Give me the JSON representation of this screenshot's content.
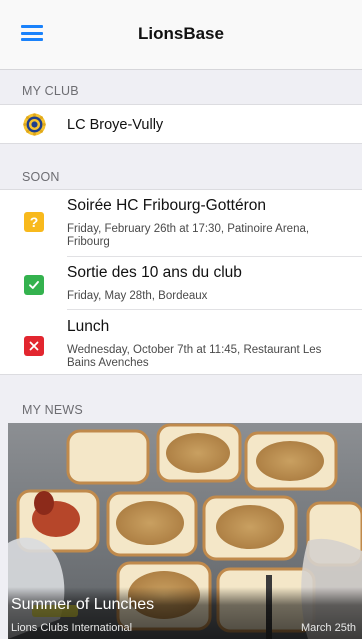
{
  "nav": {
    "title": "LionsBase",
    "menu_icon": "hamburger-menu-icon"
  },
  "my_club": {
    "header": "MY CLUB",
    "club_name": "LC Broye-Vully",
    "logo_icon": "lions-club-logo-icon"
  },
  "soon": {
    "header": "SOON",
    "events": [
      {
        "title": "Soirée HC Fribourg-Gottéron",
        "details": "Friday, February 26th at 17:30, Patinoire Arena, Fribourg",
        "status_icon": "question-mark-icon",
        "status_color": "#f8b91c"
      },
      {
        "title": "Sortie des 10 ans du club",
        "details": "Friday, May 28th, Bordeaux",
        "status_icon": "checkmark-icon",
        "status_color": "#34b24e"
      },
      {
        "title": "Lunch",
        "details": "Wednesday, October 7th at 11:45, Restaurant Les Bains Avenches",
        "status_icon": "cross-icon",
        "status_color": "#e2262f"
      }
    ]
  },
  "my_news": {
    "header": "MY NEWS",
    "items": [
      {
        "title": "Summer of Lunches",
        "source": "Lions Clubs International",
        "date": "March 25th"
      }
    ]
  },
  "colors": {
    "accent": "#1a82fb",
    "background": "#efeff4"
  }
}
